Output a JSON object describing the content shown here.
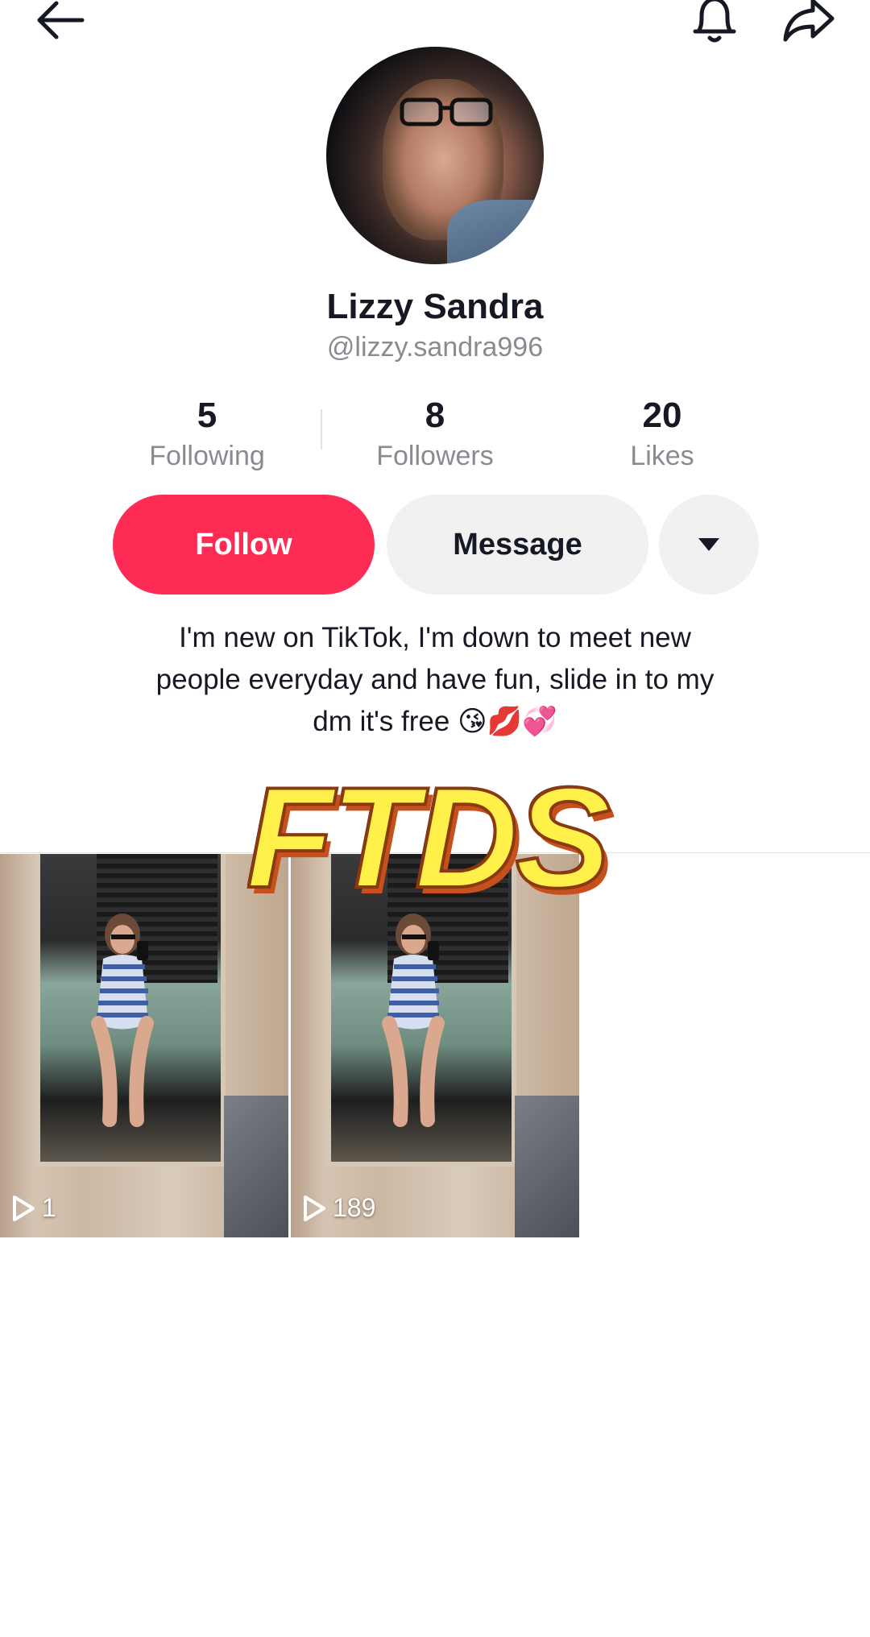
{
  "header": {
    "back_icon": "arrow-left-icon",
    "bell_icon": "bell-icon",
    "share_icon": "share-arrow-icon"
  },
  "profile": {
    "display_name": "Lizzy Sandra",
    "handle": "@lizzy.sandra996",
    "bio_line_1": "I'm new on TikTok, I'm down to meet new",
    "bio_line_2": "people everyday and have fun, slide in to my",
    "bio_line_3": "dm it's free 😘💋💞"
  },
  "stats": [
    {
      "value": "5",
      "label": "Following"
    },
    {
      "value": "8",
      "label": "Followers"
    },
    {
      "value": "20",
      "label": "Likes"
    }
  ],
  "actions": {
    "follow_label": "Follow",
    "message_label": "Message",
    "more_icon": "caret-down-icon"
  },
  "overlay": {
    "text": "FTDS"
  },
  "videos": [
    {
      "views": "1",
      "icon": "play-outline-icon"
    },
    {
      "views": "189",
      "icon": "play-outline-icon"
    }
  ],
  "colors": {
    "accent": "#fe2c55",
    "secondary_button": "#f1f1f2",
    "muted_text": "#8a8b91",
    "overlay_fill": "#fff04a"
  }
}
